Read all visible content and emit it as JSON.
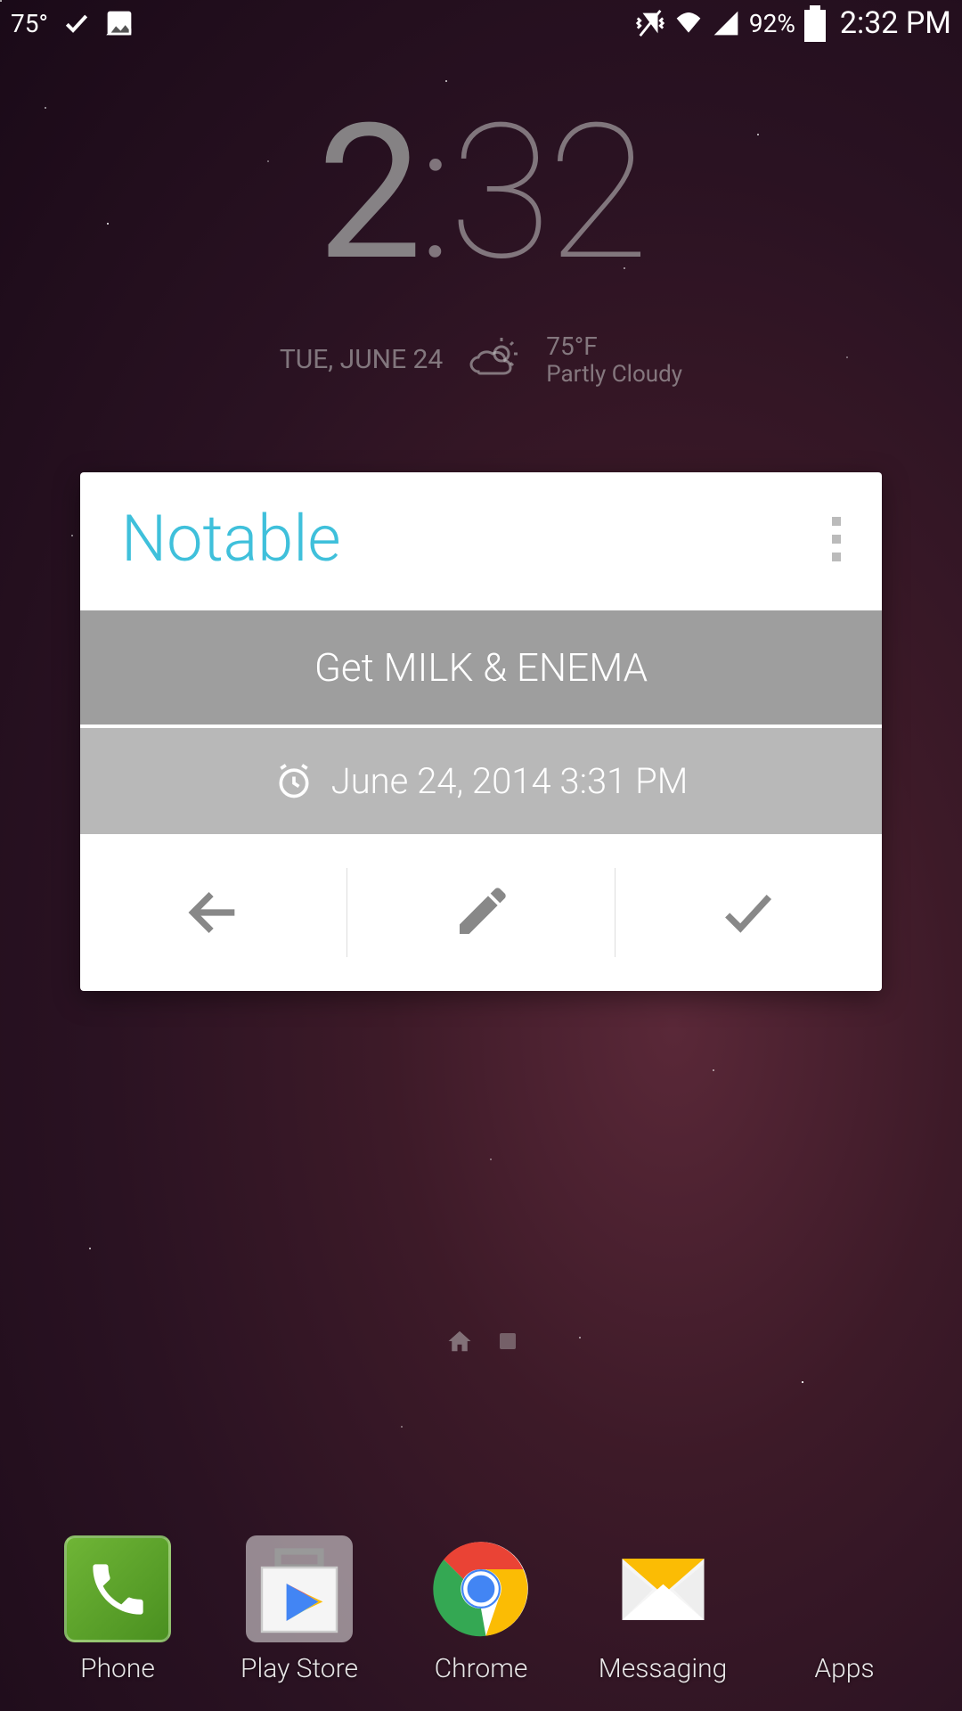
{
  "status_bar": {
    "temperature": "75°",
    "battery_percent": "92%",
    "time": "2:32 PM"
  },
  "clock": {
    "hour": "2",
    "sep": ":",
    "minute": "32",
    "date": "TUE, JUNE 24",
    "weather_temp": "75°F",
    "weather_cond": "Partly Cloudy"
  },
  "widget": {
    "title": "Notable",
    "note_text": "Get MILK & ENEMA",
    "reminder_text": "June 24, 2014 3:31 PM"
  },
  "dock": {
    "phone": "Phone",
    "play": "Play Store",
    "chrome": "Chrome",
    "messaging": "Messaging",
    "apps": "Apps"
  }
}
